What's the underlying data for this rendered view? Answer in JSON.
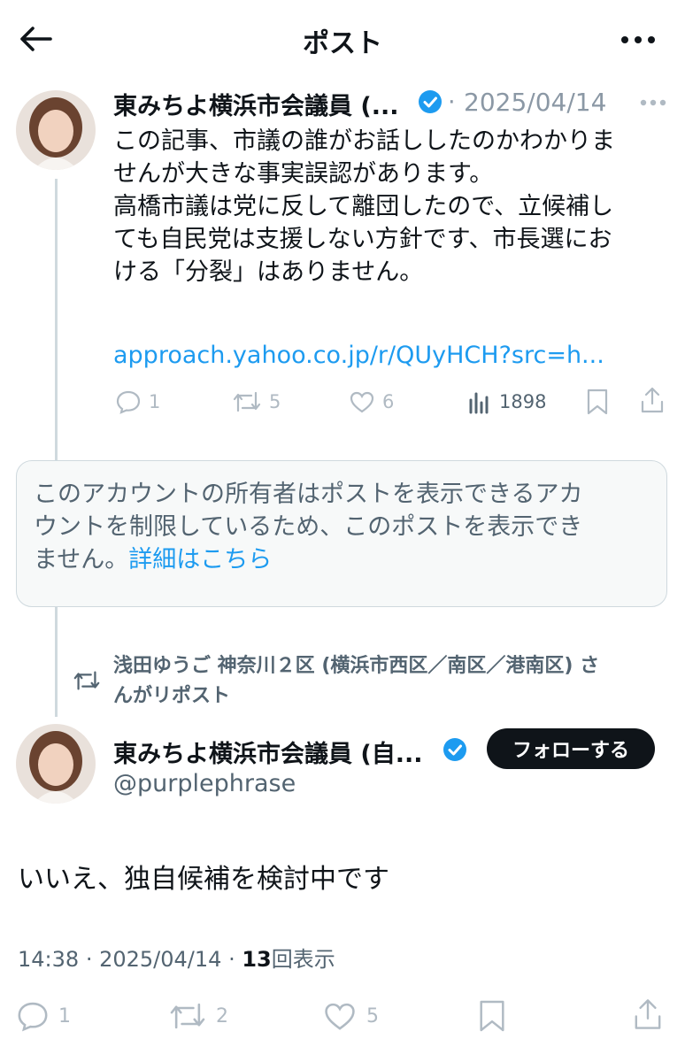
{
  "header": {
    "title": "ポスト"
  },
  "parent_post": {
    "author_name": "東みちよ横浜市会議員 (...",
    "separator": "·",
    "date": "2025/04/14",
    "body_lines": [
      "この記事、市議の誰がお話ししたのかわかりま",
      "せんが大きな事実誤認があります。",
      "高橋市議は党に反して離団したので、立候補し",
      "ても自民党は支援しない方針です、市長選にお",
      "ける「分裂」はありません。"
    ],
    "link": "approach.yahoo.co.jp/r/QUyHCH?src=h...",
    "stats": {
      "replies": "1",
      "reposts": "5",
      "likes": "6",
      "views": "1898"
    }
  },
  "restricted_notice": {
    "text_lines": [
      "このアカウントの所有者はポストを表示できるアカ",
      "ウントを制限しているため、このポストを表示でき",
      "ません。"
    ],
    "link": "詳細はこちら"
  },
  "repost_context": {
    "line1": "浅田ゆうご 神奈川２区 (横浜市西区／南区／港南区) さ",
    "line2": "んがリポスト"
  },
  "main_post": {
    "author_name": "東みちよ横浜市会議員 (自...",
    "handle": "@purplephrase",
    "follow_label": "フォローする",
    "body": "いいえ、独自候補を検討中です",
    "time": "14:38",
    "separator": "·",
    "date": "2025/04/14",
    "separator2": "·",
    "views_count": "13",
    "views_label": "回表示",
    "stats": {
      "replies": "1",
      "reposts": "2",
      "likes": "5"
    }
  },
  "colors": {
    "accent": "#1d9bf0",
    "muted": "#8b98a5",
    "text": "#0f1419"
  }
}
